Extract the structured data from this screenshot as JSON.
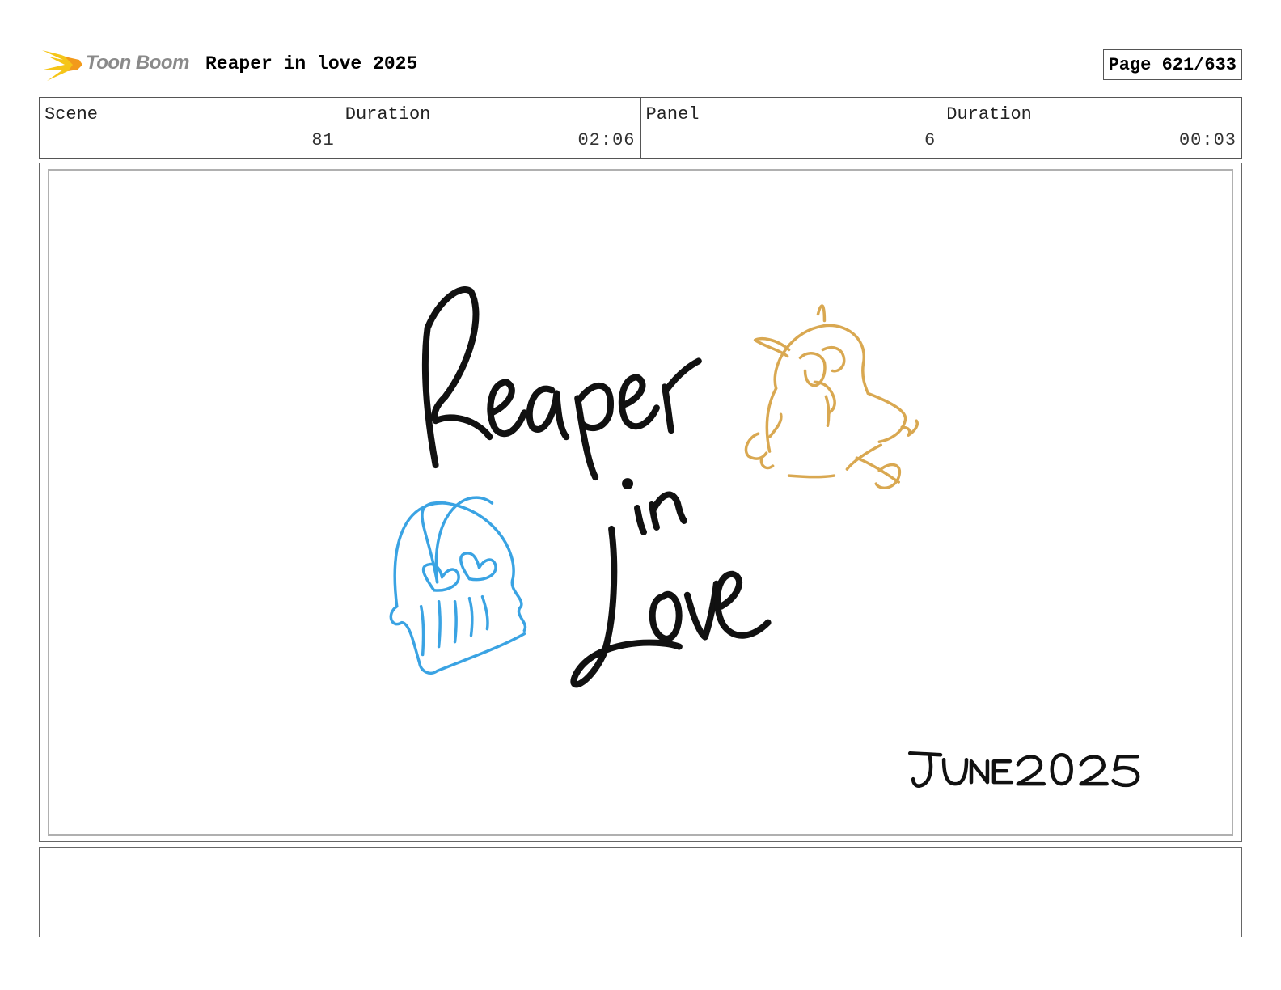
{
  "header": {
    "logo_text": "Toon Boom",
    "project_title": "Reaper in love 2025",
    "page_label": "Page 621/633"
  },
  "info": {
    "scene_label": "Scene",
    "scene_value": "81",
    "scene_duration_label": "Duration",
    "scene_duration_value": "02:06",
    "panel_label": "Panel",
    "panel_value": "6",
    "panel_duration_label": "Duration",
    "panel_duration_value": "00:03"
  },
  "artwork": {
    "title_line1": "Reaper",
    "title_line2": "in",
    "title_line3": "Love",
    "date_text": "JUNE 2025",
    "colors": {
      "ink": "#111111",
      "skull": "#3aa3e3",
      "character": "#d9a851",
      "logo_flash": "#f5c518"
    }
  },
  "notes": {
    "text": ""
  }
}
